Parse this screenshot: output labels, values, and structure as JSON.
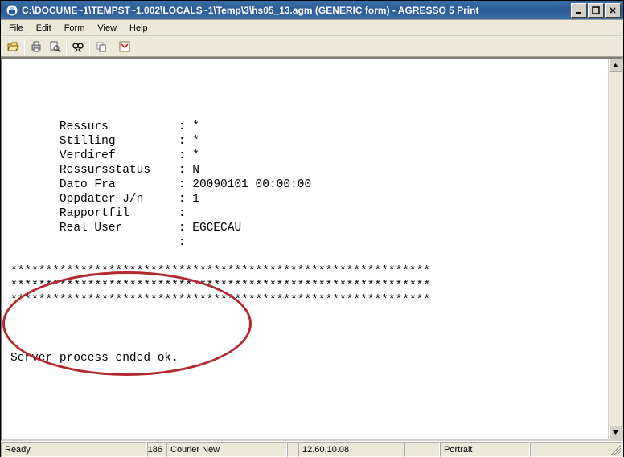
{
  "window": {
    "title": "C:\\DOCUME~1\\TEMPST~1.002\\LOCALS~1\\Temp\\3\\hs05_13.agm (GENERIC form) - AGRESSO 5 Print"
  },
  "menu": {
    "file": "File",
    "edit": "Edit",
    "form": "Form",
    "view": "View",
    "help": "Help"
  },
  "report": {
    "rows": [
      {
        "label": "Ressurs",
        "value": "*"
      },
      {
        "label": "Stilling",
        "value": "*"
      },
      {
        "label": "Verdiref",
        "value": "*"
      },
      {
        "label": "Ressursstatus",
        "value": "N"
      },
      {
        "label": "Dato Fra",
        "value": "20090101 00:00:00"
      },
      {
        "label": "Oppdater J/n",
        "value": "1"
      },
      {
        "label": "Rapportfil",
        "value": ""
      },
      {
        "label": "Real User",
        "value": "EGCECAU"
      },
      {
        "label": "",
        "value": ""
      }
    ],
    "sep": "************************************************************",
    "final": "Server process ended ok."
  },
  "status": {
    "ready": "Ready",
    "page": "186",
    "font": "Courier New",
    "pos": "12.60,10.08",
    "orient": "Portrait"
  }
}
